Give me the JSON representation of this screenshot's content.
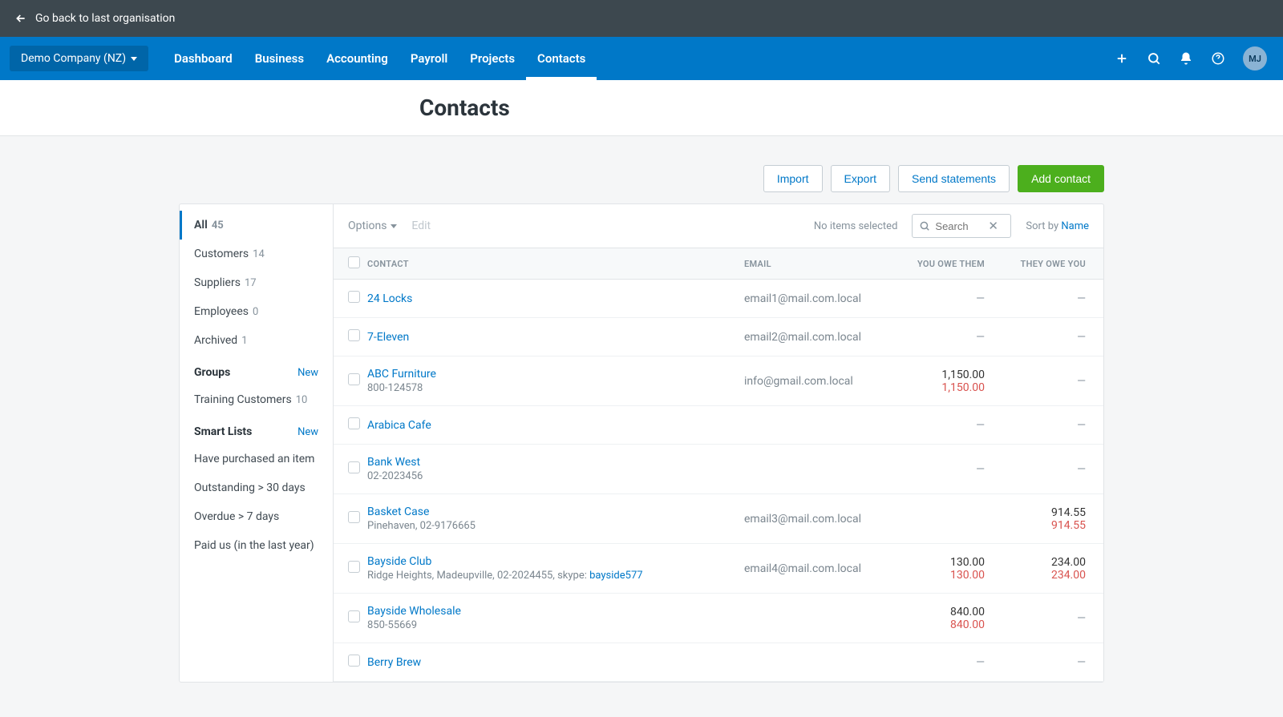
{
  "topbar": {
    "back_label": "Go back to last organisation"
  },
  "navbar": {
    "org_name": "Demo Company (NZ)",
    "links": [
      "Dashboard",
      "Business",
      "Accounting",
      "Payroll",
      "Projects",
      "Contacts"
    ],
    "active_index": 5,
    "avatar": "MJ"
  },
  "page_title": "Contacts",
  "actions": {
    "import": "Import",
    "export": "Export",
    "send": "Send statements",
    "add": "Add contact"
  },
  "sidebar": {
    "filters": [
      {
        "label": "All",
        "count": "45",
        "active": true
      },
      {
        "label": "Customers",
        "count": "14"
      },
      {
        "label": "Suppliers",
        "count": "17"
      },
      {
        "label": "Employees",
        "count": "0"
      },
      {
        "label": "Archived",
        "count": "1"
      }
    ],
    "groups_header": "Groups",
    "groups_new": "New",
    "groups": [
      {
        "label": "Training Customers",
        "count": "10"
      }
    ],
    "smart_header": "Smart Lists",
    "smart_new": "New",
    "smart": [
      "Have purchased an item",
      "Outstanding > 30 days",
      "Overdue > 7 days",
      "Paid us (in the last year)"
    ]
  },
  "toolbar": {
    "options": "Options",
    "edit": "Edit",
    "no_items": "No items selected",
    "search_placeholder": "Search",
    "sort_label": "Sort by",
    "sort_value": "Name"
  },
  "columns": {
    "contact": "CONTACT",
    "email": "EMAIL",
    "you_owe": "YOU OWE THEM",
    "they_owe": "THEY OWE YOU"
  },
  "rows": [
    {
      "name": "24 Locks",
      "sub": "",
      "email": "email1@mail.com.local",
      "you_owe": "—",
      "they_owe": "—"
    },
    {
      "name": "7-Eleven",
      "sub": "",
      "email": "email2@mail.com.local",
      "you_owe": "—",
      "they_owe": "—"
    },
    {
      "name": "ABC Furniture",
      "sub": "800-124578",
      "email": "info@gmail.com.local",
      "you_owe": "1,150.00",
      "you_owe_red": "1,150.00",
      "they_owe": "—"
    },
    {
      "name": "Arabica Cafe",
      "sub": "",
      "email": "",
      "you_owe": "—",
      "they_owe": "—"
    },
    {
      "name": "Bank West",
      "sub": "02-2023456",
      "email": "",
      "you_owe": "—",
      "they_owe": "—"
    },
    {
      "name": "Basket Case",
      "sub": "Pinehaven, 02-9176665",
      "email": "email3@mail.com.local",
      "you_owe": "",
      "they_owe": "914.55",
      "they_owe_red": "914.55"
    },
    {
      "name": "Bayside Club",
      "sub": "Ridge Heights, Madeupville, 02-2024455, skype: ",
      "sub_link": "bayside577",
      "email": "email4@mail.com.local",
      "you_owe": "130.00",
      "you_owe_red": "130.00",
      "they_owe": "234.00",
      "they_owe_red": "234.00"
    },
    {
      "name": "Bayside Wholesale",
      "sub": "850-55669",
      "email": "",
      "you_owe": "840.00",
      "you_owe_red": "840.00",
      "they_owe": "—"
    },
    {
      "name": "Berry Brew",
      "sub": "",
      "email": "",
      "you_owe": "—",
      "they_owe": "—"
    }
  ]
}
